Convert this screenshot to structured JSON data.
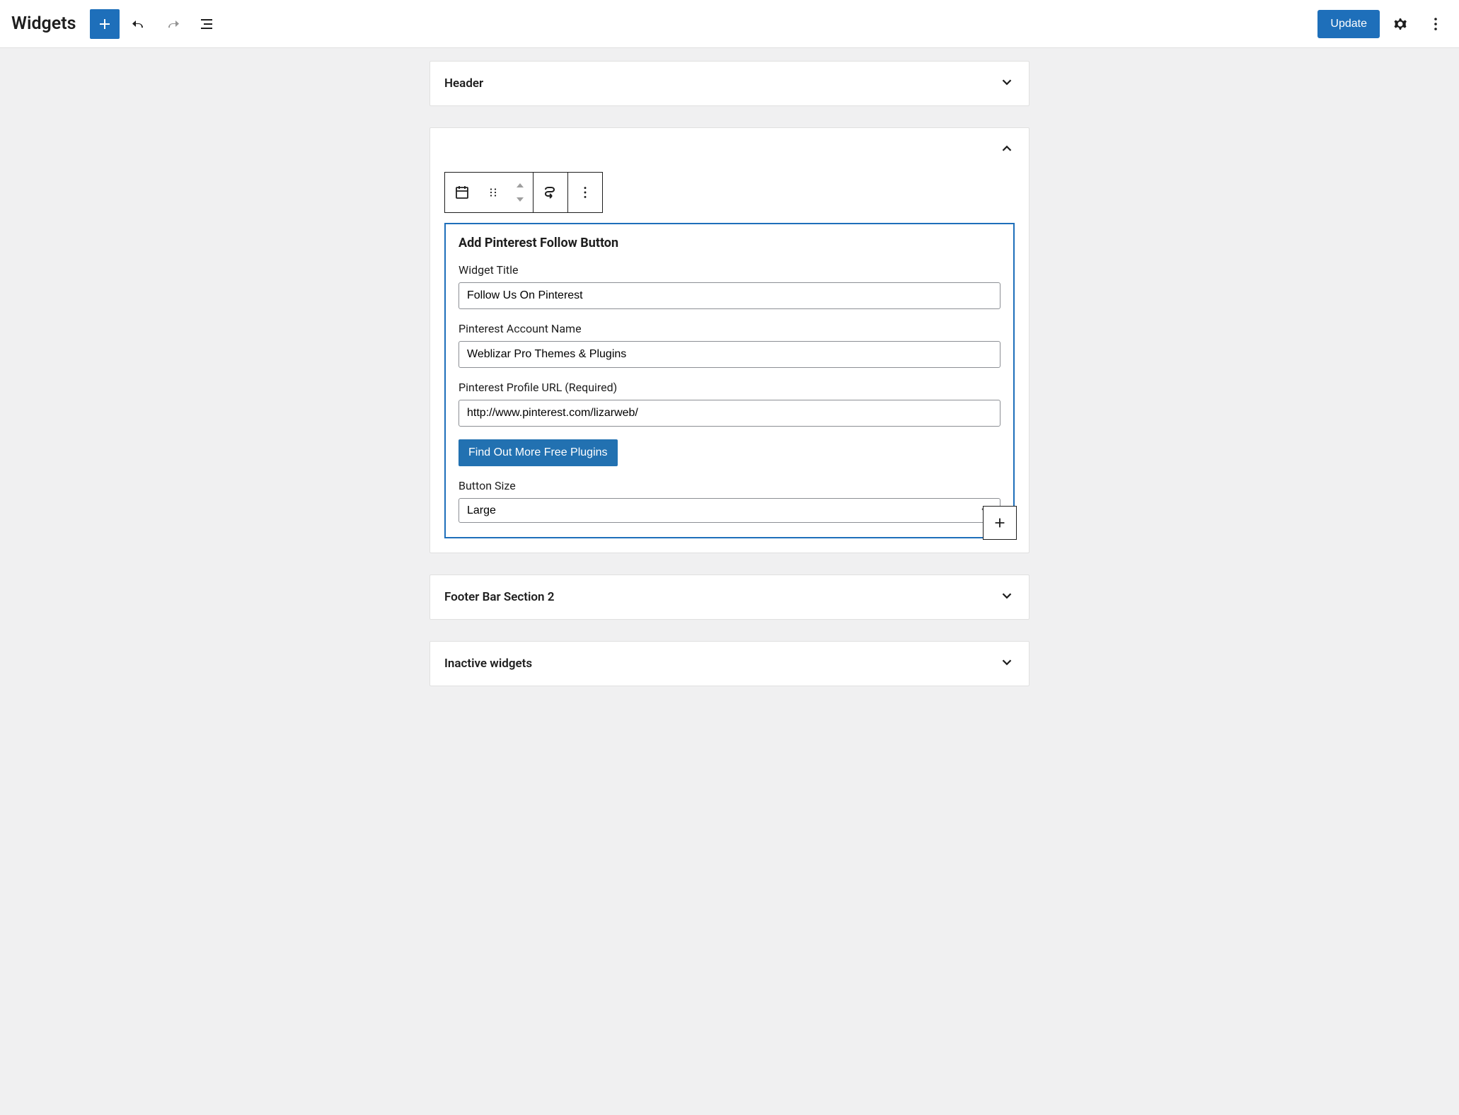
{
  "topbar": {
    "title": "Widgets",
    "update_label": "Update"
  },
  "areas": {
    "header": {
      "title": "Header"
    },
    "footer2": {
      "title": "Footer Bar Section 2"
    },
    "inactive": {
      "title": "Inactive widgets"
    }
  },
  "block": {
    "title": "Add Pinterest Follow Button",
    "fields": {
      "widget_title_label": "Widget Title",
      "widget_title_value": "Follow Us On Pinterest",
      "account_label": "Pinterest Account Name",
      "account_value": "Weblizar Pro Themes & Plugins",
      "url_label": "Pinterest Profile URL (Required)",
      "url_value": "http://www.pinterest.com/lizarweb/",
      "more_plugins_label": "Find Out More Free Plugins",
      "button_size_label": "Button Size",
      "button_size_value": "Large"
    }
  }
}
